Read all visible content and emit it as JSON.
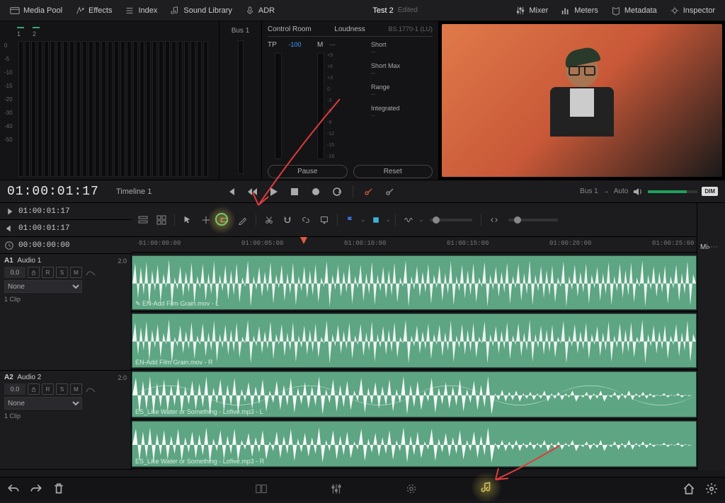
{
  "topbar": {
    "media_pool": "Media Pool",
    "effects": "Effects",
    "index": "Index",
    "sound_library": "Sound Library",
    "adr": "ADR",
    "project": "Test 2",
    "edited": "Edited",
    "mixer": "Mixer",
    "meters": "Meters",
    "metadata": "Metadata",
    "inspector": "Inspector"
  },
  "mixer": {
    "ch1": "1",
    "ch2": "2",
    "scale": [
      "0",
      "-5",
      "-10",
      "-15",
      "-20",
      "-30",
      "-40",
      "-50"
    ],
    "bus1": "Bus 1"
  },
  "control_room": {
    "title": "Control Room",
    "loudness": "Loudness",
    "standard": "BS.1770-1 (LU)",
    "tp_label": "TP",
    "tp_value": "-100",
    "m_label": "M",
    "m_value": "---",
    "scale_nums": [
      "+9",
      "+6",
      "+3",
      "0",
      "-3",
      "-6",
      "-9",
      "-12",
      "-15",
      "-18"
    ],
    "short": "Short",
    "short_max": "Short Max",
    "range": "Range",
    "integrated": "Integrated",
    "dash": "--",
    "pause": "Pause",
    "reset": "Reset"
  },
  "transport": {
    "timecode": "01:00:01:17",
    "timeline_name": "Timeline 1",
    "bus_from": "Bus 1",
    "bus_to": "Auto",
    "dim": "DIM"
  },
  "in_out": {
    "in": "01:00:01:17",
    "out": "01:00:01:17",
    "dur": "00:00:00:00"
  },
  "ruler": {
    "t0": "01:00:00:00",
    "t1": "01:00:05:00",
    "t2": "01:00:10:00",
    "t3": "01:00:15:00",
    "t4": "01:00:20:00",
    "t5": "01:00:25:00"
  },
  "tracks": {
    "a1": {
      "id": "A1",
      "name": "Audio 1",
      "db": "2.0",
      "gain": "0.0",
      "fx": "None",
      "count": "1 Clip",
      "clip_l": "EN-Add Film Grain.mov - L",
      "clip_r": "EN-Add Film Grain.mov - R"
    },
    "a2": {
      "id": "A2",
      "name": "Audio 2",
      "db": "2.0",
      "gain": "0.0",
      "fx": "None",
      "count": "1 Clip",
      "clip_l": "ES_Like Water or Something - Lofive.mp3 - L",
      "clip_r": "ES_Like Water or Something - Lofive.mp3 - R"
    },
    "R": "R",
    "S": "S",
    "M": "M"
  },
  "right_panel": {
    "mix": "Mi›"
  }
}
